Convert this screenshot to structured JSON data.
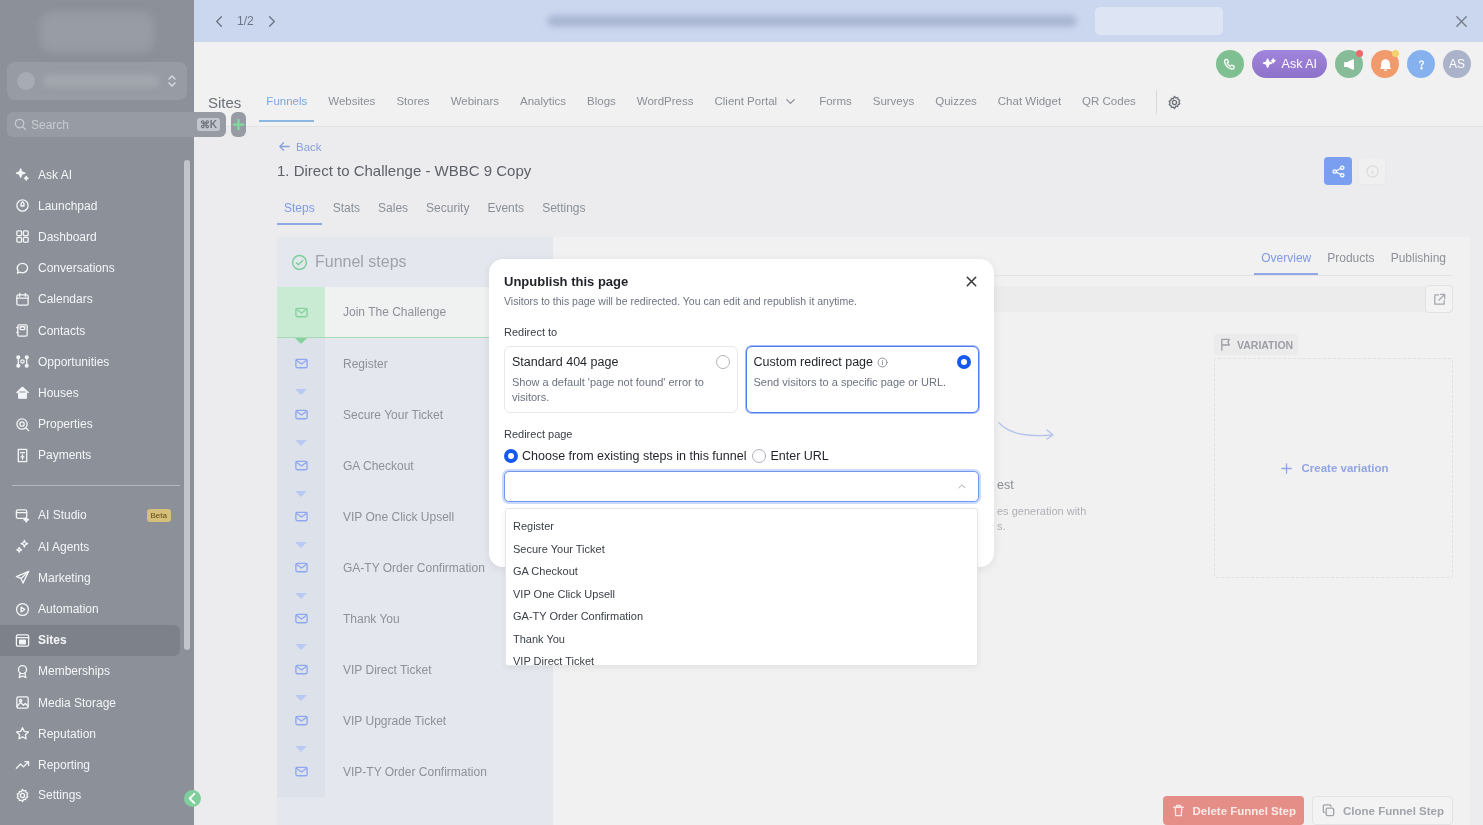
{
  "banner": {
    "pager": "1/2"
  },
  "sidebar": {
    "search": {
      "placeholder": "Search",
      "shortcut": "⌘K"
    },
    "groups": [
      [
        {
          "label": "Ask AI",
          "selected": false
        },
        {
          "label": "Launchpad",
          "selected": false
        },
        {
          "label": "Dashboard",
          "selected": false
        },
        {
          "label": "Conversations",
          "selected": false
        },
        {
          "label": "Calendars",
          "selected": false
        },
        {
          "label": "Contacts",
          "selected": false
        },
        {
          "label": "Opportunities",
          "selected": false
        },
        {
          "label": "Houses",
          "selected": false
        },
        {
          "label": "Properties",
          "selected": false
        },
        {
          "label": "Payments",
          "selected": false
        }
      ],
      [
        {
          "label": "AI Studio",
          "selected": false,
          "badge": "Beta"
        },
        {
          "label": "AI Agents",
          "selected": false
        },
        {
          "label": "Marketing",
          "selected": false
        },
        {
          "label": "Automation",
          "selected": false
        },
        {
          "label": "Sites",
          "selected": true
        },
        {
          "label": "Memberships",
          "selected": false
        },
        {
          "label": "Media Storage",
          "selected": false
        },
        {
          "label": "Reputation",
          "selected": false
        },
        {
          "label": "Reporting",
          "selected": false
        }
      ]
    ],
    "settings": "Settings"
  },
  "header": {
    "ask_ai": "Ask AI",
    "avatar": "AS",
    "megaphone_unread": true,
    "bell_unread": true
  },
  "nav": {
    "title": "Sites",
    "tabs": [
      {
        "label": "Funnels",
        "selected": true,
        "has_menu": false
      },
      {
        "label": "Websites",
        "selected": false,
        "has_menu": false
      },
      {
        "label": "Stores",
        "selected": false,
        "has_menu": false
      },
      {
        "label": "Webinars",
        "selected": false,
        "has_menu": false
      },
      {
        "label": "Analytics",
        "selected": false,
        "has_menu": false
      },
      {
        "label": "Blogs",
        "selected": false,
        "has_menu": false
      },
      {
        "label": "WordPress",
        "selected": false,
        "has_menu": false
      },
      {
        "label": "Client Portal",
        "selected": false,
        "has_menu": true
      },
      {
        "label": "Forms",
        "selected": false,
        "has_menu": false
      },
      {
        "label": "Surveys",
        "selected": false,
        "has_menu": false
      },
      {
        "label": "Quizzes",
        "selected": false,
        "has_menu": false
      },
      {
        "label": "Chat Widget",
        "selected": false,
        "has_menu": false
      },
      {
        "label": "QR Codes",
        "selected": false,
        "has_menu": false
      }
    ]
  },
  "page": {
    "back": "Back",
    "title": "1. Direct to Challenge - WBBC 9 Copy",
    "tabs": [
      {
        "label": "Steps",
        "selected": true
      },
      {
        "label": "Stats",
        "selected": false
      },
      {
        "label": "Sales",
        "selected": false
      },
      {
        "label": "Security",
        "selected": false
      },
      {
        "label": "Events",
        "selected": false
      },
      {
        "label": "Settings",
        "selected": false
      }
    ]
  },
  "funnel": {
    "title": "Funnel steps",
    "steps": [
      {
        "name": "Join The Challenge",
        "selected": true
      },
      {
        "name": "Register",
        "selected": false
      },
      {
        "name": "Secure Your Ticket",
        "selected": false
      },
      {
        "name": "GA Checkout",
        "selected": false
      },
      {
        "name": "VIP One Click Upsell",
        "selected": false
      },
      {
        "name": "GA-TY Order Confirmation",
        "selected": false
      },
      {
        "name": "Thank You",
        "selected": false
      },
      {
        "name": "VIP Direct Ticket",
        "selected": false
      },
      {
        "name": "VIP Upgrade Ticket",
        "selected": false
      },
      {
        "name": "VIP-TY Order Confirmation",
        "selected": false
      }
    ]
  },
  "details": {
    "tabs": [
      {
        "label": "Overview",
        "selected": true
      },
      {
        "label": "Products",
        "selected": false
      },
      {
        "label": "Publishing",
        "selected": false
      }
    ],
    "partial_title": "est",
    "partial_text": [
      "es generation with",
      "s."
    ],
    "variation": {
      "label": "VARIATION",
      "action": "Create variation"
    },
    "delete": "Delete Funnel Step",
    "clone": "Clone Funnel Step"
  },
  "modal": {
    "title": "Unpublish this page",
    "subtitle": "Visitors to this page will be redirected. You can edit and republish it anytime.",
    "redirect_label": "Redirect to",
    "options": [
      {
        "title": "Standard 404 page",
        "description": "Show a default 'page not found' error to visitors.",
        "selected": false,
        "info": false
      },
      {
        "title": "Custom redirect page",
        "description": "Send visitors to a specific page or URL.",
        "selected": true,
        "info": true
      }
    ],
    "page_label": "Redirect page",
    "sources": [
      {
        "label": "Choose from existing steps in this funnel",
        "selected": true
      },
      {
        "label": "Enter URL",
        "selected": false
      }
    ],
    "select": {
      "open": true
    },
    "choices": [
      "Register",
      "Secure Your Ticket",
      "GA Checkout",
      "VIP One Click Upsell",
      "GA-TY Order Confirmation",
      "Thank You",
      "VIP Direct Ticket"
    ]
  }
}
